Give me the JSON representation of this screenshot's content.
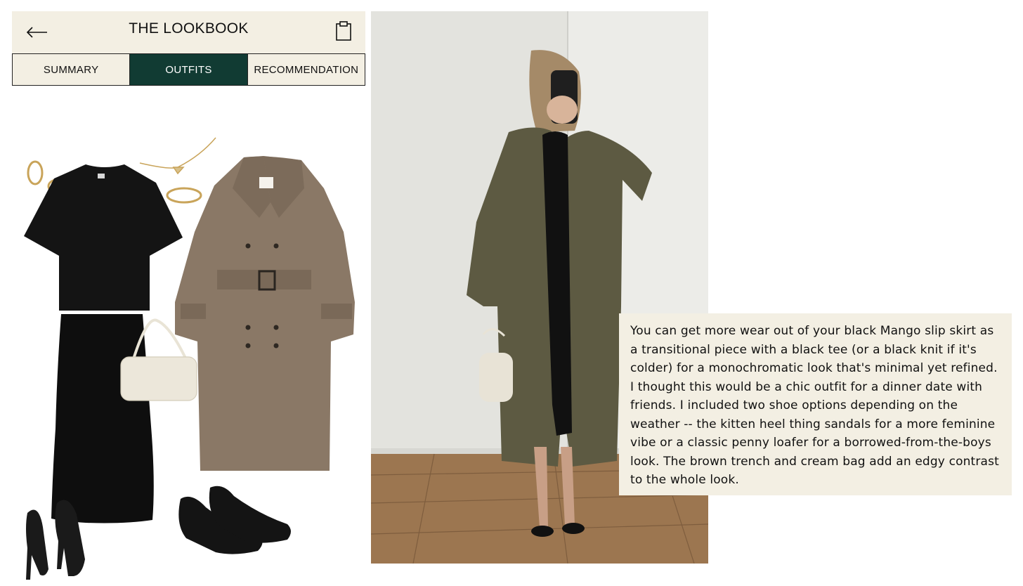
{
  "header": {
    "title": "THE LOOKBOOK",
    "back_icon": "arrow-left-icon",
    "action_icon": "clipboard-icon"
  },
  "tabs": [
    {
      "label": "SUMMARY",
      "active": false
    },
    {
      "label": "OUTFITS",
      "active": true
    },
    {
      "label": "RECOMMENDATION",
      "active": false
    }
  ],
  "colors": {
    "panel_bg": "#f3efe3",
    "active_tab": "#113b33",
    "trench": "#8a7866"
  },
  "collage_items": [
    "gold-hoop-earrings",
    "black-tee",
    "gold-necklace",
    "gold-ring",
    "trench-coat",
    "cream-shoulder-bag",
    "black-slip-skirt",
    "black-kitten-heel-sandals",
    "black-penny-loafers"
  ],
  "caption": {
    "text": "You can get more wear out of your black Mango slip skirt as a transitional piece with a black tee (or a black knit if it's colder) for a monochromatic look that's minimal yet refined. I thought this would be a chic outfit for a dinner date with friends. I included two shoe options depending on the weather -- the kitten heel thing sandals for a more feminine vibe or a classic penny loafer for a borrowed-from-the-boys look. The brown trench and cream bag add an edgy contrast to the whole look."
  }
}
